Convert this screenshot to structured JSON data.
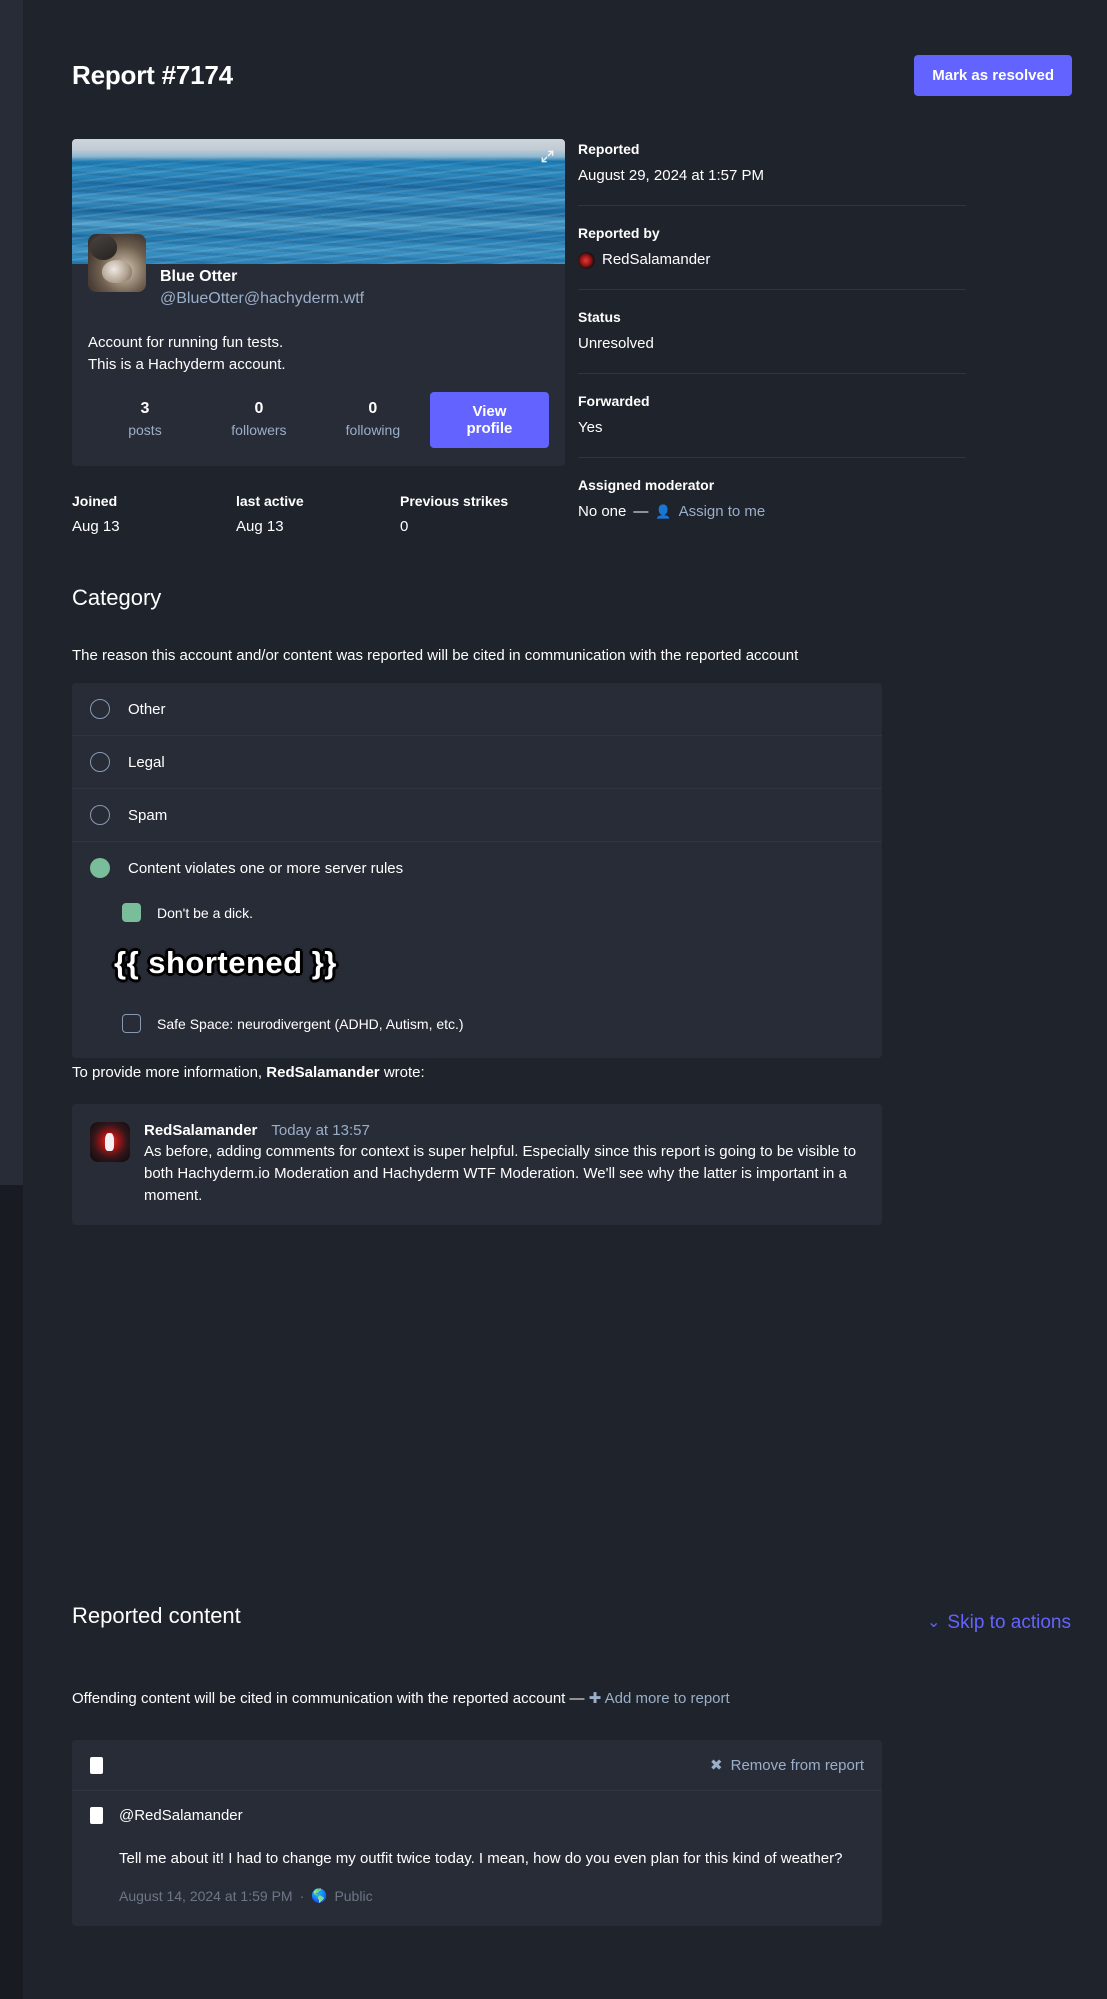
{
  "header": {
    "title": "Report #7174",
    "resolve_button": "Mark as resolved"
  },
  "account": {
    "display_name": "Blue Otter",
    "handle": "@BlueOtter@hachyderm.wtf",
    "bio_line1": "Account for running fun tests.",
    "bio_line2": "This is a Hachyderm account.",
    "stats": [
      {
        "value": "3",
        "label": "posts"
      },
      {
        "value": "0",
        "label": "followers"
      },
      {
        "value": "0",
        "label": "following"
      }
    ],
    "view_profile_button": "View profile",
    "meta": [
      {
        "label": "Joined",
        "value": "Aug 13"
      },
      {
        "label": "last active",
        "value": "Aug 13"
      },
      {
        "label": "Previous strikes",
        "value": "0"
      }
    ]
  },
  "report_meta": [
    {
      "label": "Reported",
      "value": "August 29, 2024 at 1:57 PM"
    },
    {
      "label": "Reported by",
      "value": "RedSalamander"
    },
    {
      "label": "Status",
      "value": "Unresolved"
    },
    {
      "label": "Forwarded",
      "value": "Yes"
    },
    {
      "label": "Assigned moderator",
      "value": "No one",
      "separator": "—",
      "link": "Assign to me"
    }
  ],
  "category": {
    "heading": "Category",
    "description": "The reason this account and/or content was reported will be cited in communication with the reported account",
    "options": [
      {
        "label": "Other",
        "selected": false
      },
      {
        "label": "Legal",
        "selected": false
      },
      {
        "label": "Spam",
        "selected": false
      },
      {
        "label": "Content violates one or more server rules",
        "selected": true
      }
    ],
    "rules": [
      {
        "label": "Don't be a dick.",
        "checked": true
      },
      {
        "label": "Safe Space: neurodivergent (ADHD, Autism, etc.)",
        "checked": false
      }
    ],
    "shortened_marker": "{{ shortened }}"
  },
  "comment_section": {
    "intro_prefix": "To provide more information,",
    "intro_author": "RedSalamander",
    "intro_suffix": "wrote:",
    "author": "RedSalamander",
    "time": "Today at 13:57",
    "text": "As before, adding comments for context is super helpful. Especially since this report is going to be visible to both Hachyderm.io Moderation and Hachyderm WTF Moderation. We'll see why the latter is important in a moment."
  },
  "reported_content": {
    "heading": "Reported content",
    "skip_link": "Skip to actions",
    "description": "Offending content will be cited in communication with the reported account —",
    "add_more_link": "Add more to report",
    "remove_link": "Remove from report",
    "post": {
      "handle": "@RedSalamander",
      "text": "Tell me about it! I had to change my outfit twice today. I mean, how do you even plan for this kind of weather?",
      "timestamp": "August 14, 2024 at 1:59 PM",
      "separator": "·",
      "visibility": "Public"
    }
  },
  "colors": {
    "accent": "#6364ff",
    "page_bg": "#191b22",
    "panel_bg": "#1f232b",
    "card_bg": "#282c37",
    "muted_text": "#9baec8",
    "selected_green": "#79bd9a"
  }
}
